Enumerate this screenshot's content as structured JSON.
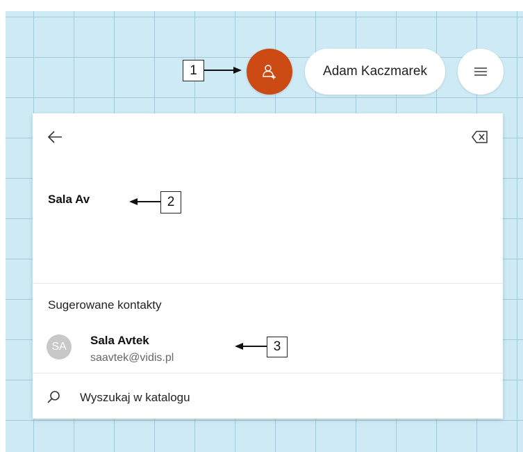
{
  "header": {
    "add_person_icon": "add-person-icon",
    "user_name": "Adam Kaczmarek",
    "menu_icon": "hamburger-menu-icon"
  },
  "callouts": {
    "c1": "1",
    "c2": "2",
    "c3": "3"
  },
  "panel": {
    "back_icon": "back-arrow-icon",
    "clear_icon": "backspace-clear-icon",
    "meeting_title": "Sala Av",
    "suggested_header": "Sugerowane kontakty",
    "contact": {
      "initials": "SA",
      "name": "Sala Avtek",
      "email": "saavtek@vidis.pl"
    },
    "search_label": "Wyszukaj w katalogu",
    "search_icon": "search-icon"
  },
  "colors": {
    "accent": "#cc4a14",
    "background_grid": "#cdeaf5",
    "avatar": "#c8c8c8"
  }
}
